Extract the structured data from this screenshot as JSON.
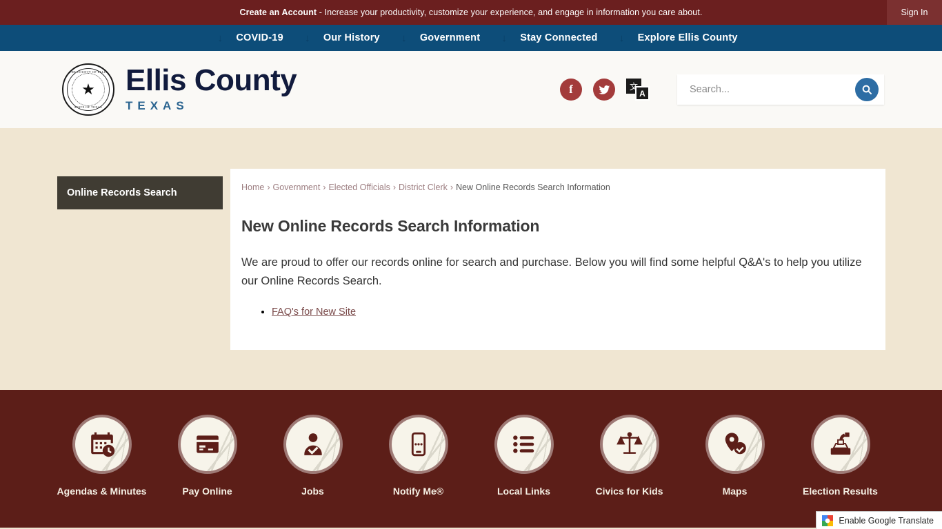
{
  "topbar": {
    "alert_bold": "Create an Account",
    "alert_rest": " - Increase your productivity, customize your experience, and engage in information you care about.",
    "signin_label": "Sign In",
    "bg": "#6b1f1f"
  },
  "nav": {
    "bg": "#0d4d79",
    "items": [
      {
        "label": "COVID-19",
        "caret": "↓"
      },
      {
        "label": "Our History",
        "caret": "↓"
      },
      {
        "label": "Government",
        "caret": "↓"
      },
      {
        "label": "Stay Connected",
        "caret": "↓"
      },
      {
        "label": "Explore Ellis County",
        "caret": "↓"
      }
    ]
  },
  "header": {
    "seal_top_text": "THE COUNTY OF ELLIS",
    "seal_bottom_text": "STATE OF TEXAS",
    "seal_star": "★",
    "brand_name": "Ellis County",
    "brand_sub": "TEXAS",
    "facebook_glyph": "f",
    "twitter_glyph": "ᴠ",
    "translate_glyph_1": "文",
    "translate_glyph_2": "A",
    "search_placeholder": "Search...",
    "search_value": "",
    "search_icon": "⚲",
    "accent_blue": "#2d6da4",
    "social_red": "#a33b3b"
  },
  "sidebar": {
    "items": [
      {
        "label": "Online Records Search",
        "active": true
      }
    ]
  },
  "breadcrumb": {
    "separator": "›",
    "items": [
      {
        "label": "Home",
        "link": true
      },
      {
        "label": "Government",
        "link": true
      },
      {
        "label": "Elected Officials",
        "link": true
      },
      {
        "label": "District Clerk",
        "link": true
      },
      {
        "label": "New Online Records Search Information",
        "link": false
      }
    ]
  },
  "main": {
    "title": "New Online Records Search Information",
    "intro": "We are proud to offer our records online for search and purchase. Below you will find some helpful Q&A's to help you utilize our Online Records Search.",
    "links": [
      {
        "label": "FAQ's for New Site"
      }
    ]
  },
  "footer": {
    "bg": "#5c1e18",
    "quick_links": [
      {
        "label": "Agendas & Minutes",
        "icon": "calendar-clock-icon"
      },
      {
        "label": "Pay Online",
        "icon": "credit-card-icon"
      },
      {
        "label": "Jobs",
        "icon": "person-check-icon"
      },
      {
        "label": "Notify Me®",
        "icon": "mobile-phone-icon"
      },
      {
        "label": "Local Links",
        "icon": "bullet-list-icon"
      },
      {
        "label": "Civics for Kids",
        "icon": "scales-icon"
      },
      {
        "label": "Maps",
        "icon": "map-pin-check-icon"
      },
      {
        "label": "Election Results",
        "icon": "ballot-box-icon"
      }
    ]
  },
  "translate_widget": {
    "label": "Enable Google Translate",
    "logo": "google-g-icon"
  }
}
